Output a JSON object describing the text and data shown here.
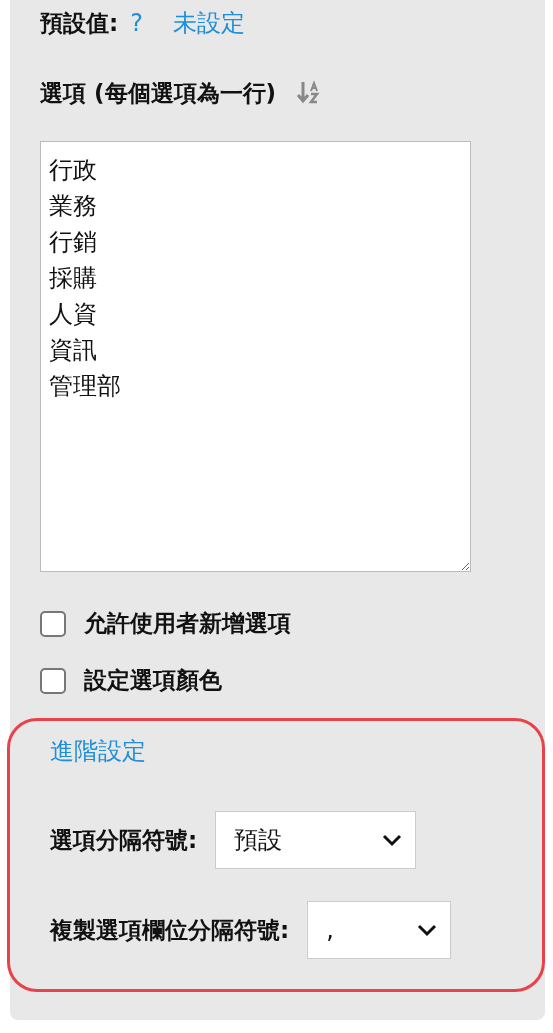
{
  "default_value": {
    "label": "預設值:",
    "help": "?",
    "value": "未設定"
  },
  "options": {
    "label": "選項 (每個選項為一行)",
    "lines": [
      "行政",
      "業務",
      "行銷",
      "採購",
      "人資",
      "資訊",
      "管理部"
    ]
  },
  "checkboxes": [
    {
      "label": "允許使用者新增選項",
      "checked": false
    },
    {
      "label": "設定選項顏色",
      "checked": false
    }
  ],
  "advanced": {
    "link": "進階設定",
    "highlighted": true,
    "fields": [
      {
        "label": "選項分隔符號:",
        "value": "預設"
      },
      {
        "label": "複製選項欄位分隔符號:",
        "value": ","
      }
    ]
  }
}
